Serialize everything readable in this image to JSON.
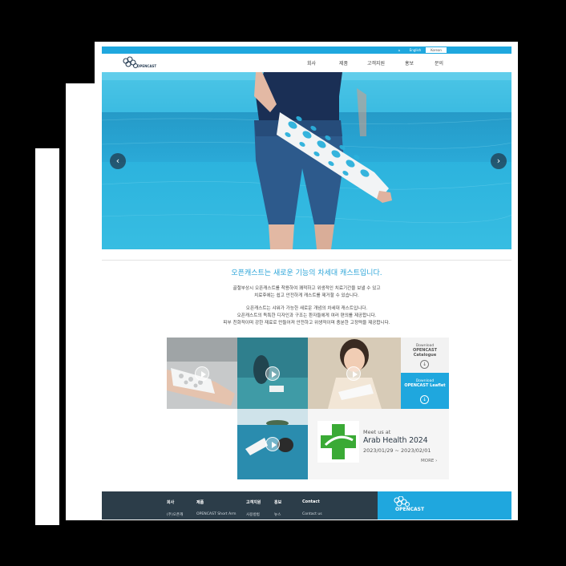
{
  "topbar": {
    "home": "⌂",
    "english": "English",
    "korean": "Korean"
  },
  "header": {
    "logo_text": "OPENCAST",
    "nav": [
      "회사",
      "제품",
      "고객지원",
      "홍보",
      "문의"
    ]
  },
  "hero": {
    "prev_label": "‹",
    "next_label": "›"
  },
  "intro": {
    "tagline": "오픈캐스트는 새로운 기능의 차세대 캐스트입니다.",
    "para1": [
      "골절부상시 오픈캐스트를 착용하여 쾌적하고 위생적인 치료기간을 보낼 수 있고",
      "치료후에는 쉽고 안전하게 캐스트를 제거할 수 있습니다."
    ],
    "para2": [
      "오픈캐스트는 샤워가 가능한 새로운 개념의 차세대 캐스트입니다.",
      "오픈캐스트의 독특한 디자인과 구조는 환자들에게 여러 편의를 제공합니다.",
      "피부 친화적이며 강한 재료로 만들어져 안전하고 위생적이며 충분한 고정력을 제공합니다."
    ]
  },
  "downloads": [
    {
      "small": "Download",
      "title": "OPENCAST Catalogue",
      "icon": "↓"
    },
    {
      "small": "Download",
      "title": "OPENCAST Leaflet",
      "icon": "↓"
    }
  ],
  "event": {
    "meet": "Meet us at",
    "title": "Arab Health 2024",
    "dates": "2023/01/29 ~ 2023/02/01",
    "more": "MORE  ›"
  },
  "footer": {
    "cols": [
      {
        "head": "회사",
        "item": "(주)오픈캐"
      },
      {
        "head": "제품",
        "item": "OPENCAST Short Arm"
      },
      {
        "head": "고객지원",
        "item": "사용방법"
      },
      {
        "head": "홍보",
        "item": "뉴스"
      },
      {
        "head": "Contact",
        "item": "Contact us"
      }
    ],
    "logo_text": "OPENCAST"
  },
  "colors": {
    "accent": "#1fa7de",
    "footer": "#2c3d49",
    "pool": "#33b8df",
    "event_green": "#3aaa35"
  }
}
